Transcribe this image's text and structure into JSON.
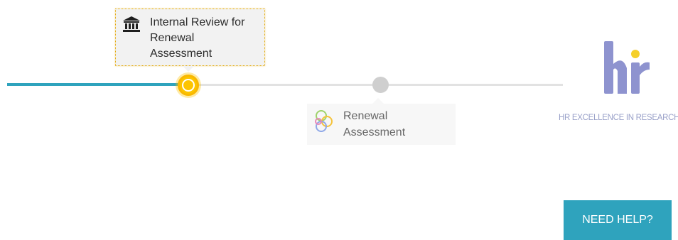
{
  "timeline": {
    "steps": [
      {
        "label": "Internal Review for Renewal Assessment",
        "state": "current",
        "icon": "bank-icon"
      },
      {
        "label": "Renewal Assessment",
        "state": "upcoming",
        "icon": "rings-icon"
      }
    ]
  },
  "logo": {
    "caption": "HR EXCELLENCE IN RESEARCH"
  },
  "help": {
    "label": "NEED HELP?"
  },
  "colors": {
    "accent": "#2fa3bd",
    "active_node": "#fcc400",
    "inactive_node": "#cfcfcf",
    "logo_purple": "#8e93cf",
    "logo_yellow": "#f5d02a"
  }
}
